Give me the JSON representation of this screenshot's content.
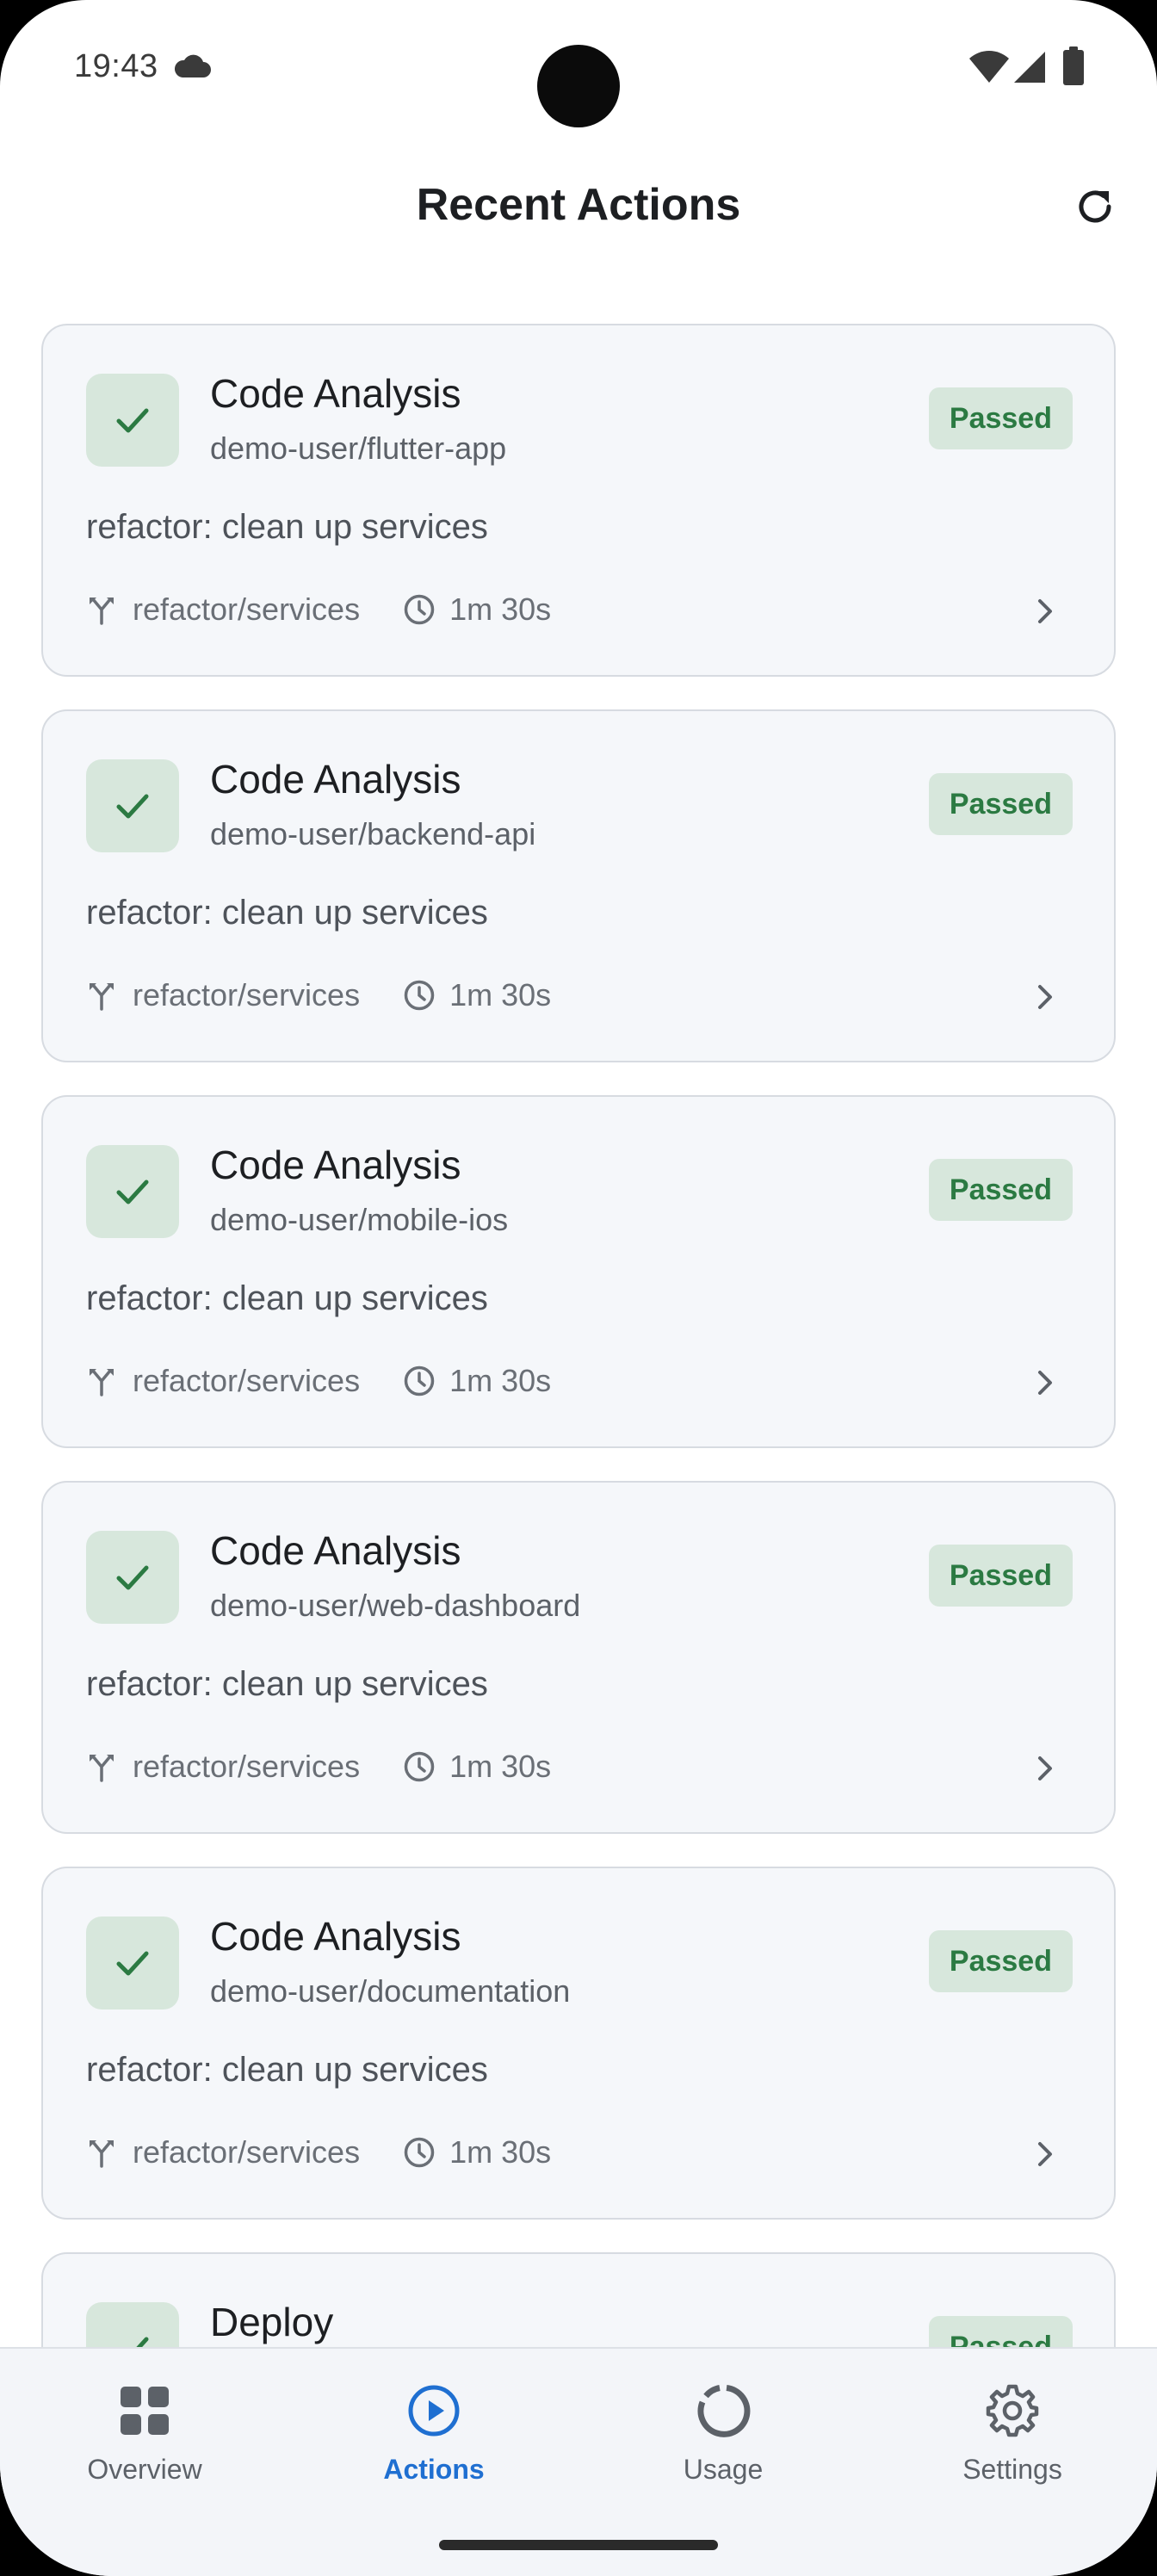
{
  "status_bar": {
    "time": "19:43"
  },
  "header": {
    "title": "Recent Actions"
  },
  "actions": [
    {
      "title": "Code Analysis",
      "repo": "demo-user/flutter-app",
      "status": "Passed",
      "commit": "refactor: clean up services",
      "branch": "refactor/services",
      "duration": "1m 30s"
    },
    {
      "title": "Code Analysis",
      "repo": "demo-user/backend-api",
      "status": "Passed",
      "commit": "refactor: clean up services",
      "branch": "refactor/services",
      "duration": "1m 30s"
    },
    {
      "title": "Code Analysis",
      "repo": "demo-user/mobile-ios",
      "status": "Passed",
      "commit": "refactor: clean up services",
      "branch": "refactor/services",
      "duration": "1m 30s"
    },
    {
      "title": "Code Analysis",
      "repo": "demo-user/web-dashboard",
      "status": "Passed",
      "commit": "refactor: clean up services",
      "branch": "refactor/services",
      "duration": "1m 30s"
    },
    {
      "title": "Code Analysis",
      "repo": "demo-user/documentation",
      "status": "Passed",
      "commit": "refactor: clean up services",
      "branch": "refactor/services",
      "duration": "1m 30s"
    },
    {
      "title": "Deploy",
      "status": "Passed"
    }
  ],
  "bottom_nav": {
    "items": [
      {
        "label": "Overview",
        "icon": "grid-icon"
      },
      {
        "label": "Actions",
        "icon": "play-circle-icon"
      },
      {
        "label": "Usage",
        "icon": "donut-icon"
      },
      {
        "label": "Settings",
        "icon": "gear-icon"
      }
    ],
    "active": "Actions"
  },
  "colors": {
    "accent": "#1f6fd1",
    "passed_text": "#2b7a42",
    "passed_bg": "#d7e7dc",
    "card_bg": "#f5f7fa",
    "card_border": "#d7dbe1"
  }
}
